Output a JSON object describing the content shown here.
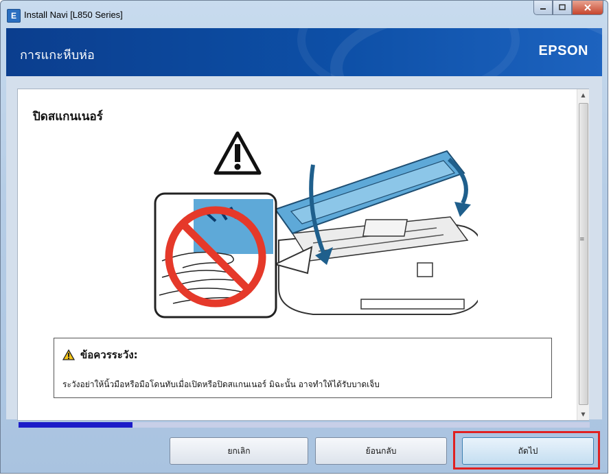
{
  "window": {
    "title": "Install Navi [L850 Series]",
    "icon": "app-icon"
  },
  "header": {
    "title": "การแกะหีบห่อ",
    "brand": "EPSON"
  },
  "main": {
    "heading": "ปิดสแกนเนอร์"
  },
  "caution": {
    "title": "ข้อควรระวัง:",
    "text": "ระวังอย่าให้นิ้วมือหรือมือโดนทับเมื่อเปิดหรือปิดสแกนเนอร์ มิฉะนั้น อาจทำให้ได้รับบาดเจ็บ"
  },
  "progress": {
    "fraction": 0.2
  },
  "buttons": {
    "cancel": "ยกเลิก",
    "back": "ย้อนกลับ",
    "next": "ถัดไป"
  },
  "colors": {
    "header": "#0d4fa6",
    "progress": "#1c1cc8",
    "highlight": "#e02020",
    "printer_lid": "#5ea9d8"
  }
}
